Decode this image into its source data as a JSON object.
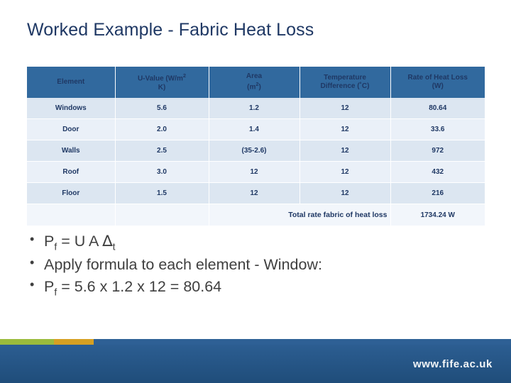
{
  "slide": {
    "title": "Worked Example - Fabric Heat Loss",
    "table": {
      "headers": [
        "Element",
        "U-Value    (W/m² K)",
        "Area (m²)",
        "Temperature Difference (˚C)",
        "Rate of Heat Loss (W)"
      ],
      "header_parts": {
        "uvalue_line1": "U-Value    (W/m",
        "uvalue_sup": "2",
        "uvalue_line2": "K)",
        "area_line1": "Area",
        "area_line2": "(m",
        "area_sup": "2",
        "area_line2_end": ")",
        "temp_line1": "Temperature",
        "temp_line2": "Difference (˚C)",
        "rate_line1": "Rate of Heat Loss",
        "rate_line2": "(W)"
      },
      "rows": [
        {
          "element": "Windows",
          "uvalue": "5.6",
          "area": "1.2",
          "temp": "12",
          "rate": "80.64"
        },
        {
          "element": "Door",
          "uvalue": "2.0",
          "area": "1.4",
          "temp": "12",
          "rate": "33.6"
        },
        {
          "element": "Walls",
          "uvalue": "2.5",
          "area": "(35-2.6)",
          "temp": "12",
          "rate": "972"
        },
        {
          "element": "Roof",
          "uvalue": "3.0",
          "area": "12",
          "temp": "12",
          "rate": "432"
        },
        {
          "element": "Floor",
          "uvalue": "1.5",
          "area": "12",
          "temp": "12",
          "rate": "216"
        }
      ],
      "total_label": "Total rate fabric of heat loss",
      "total_value": "1734.24 W"
    },
    "bullets": {
      "line1_prefix": "P",
      "line1_sub": "f",
      "line1_rest": " = U A ",
      "line1_delta": "∆",
      "line1_sub2": "t",
      "line2": "Apply formula to each element - Window:",
      "line3_prefix": "P",
      "line3_sub": "f",
      "line3_rest": " = 5.6 x 1.2 x 12 = 80.64"
    },
    "footer": {
      "url": "www.fife.ac.uk"
    }
  }
}
